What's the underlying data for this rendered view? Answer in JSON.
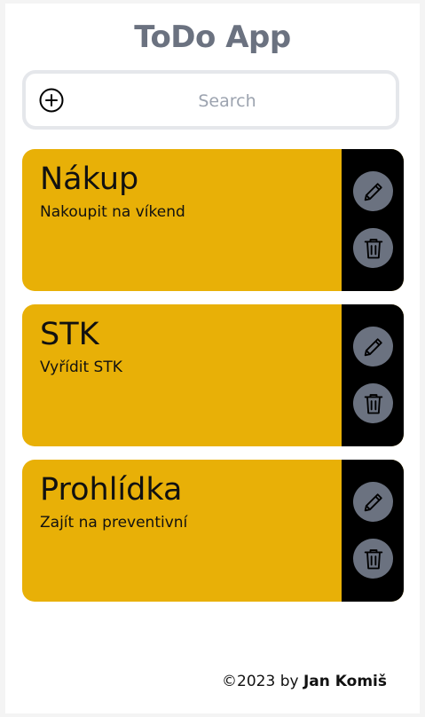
{
  "header": {
    "title": "ToDo App"
  },
  "search": {
    "placeholder": "Search",
    "value": "",
    "add_icon": "plus-circle-icon"
  },
  "todos": [
    {
      "title": "Nákup",
      "description": "Nakoupit na víkend",
      "edit_icon": "pencil-icon",
      "delete_icon": "trash-icon"
    },
    {
      "title": "STK",
      "description": "Vyřídit STK",
      "edit_icon": "pencil-icon",
      "delete_icon": "trash-icon"
    },
    {
      "title": "Prohlídka",
      "description": "Zajít na preventivní",
      "edit_icon": "pencil-icon",
      "delete_icon": "trash-icon"
    }
  ],
  "footer": {
    "copyright": "©2023 by",
    "author": "Jan Komiš"
  },
  "colors": {
    "card": "#e8b007",
    "actions_panel": "#000000",
    "action_button": "#6b7280",
    "title": "#6b7280",
    "search_border": "#e5e7eb"
  }
}
